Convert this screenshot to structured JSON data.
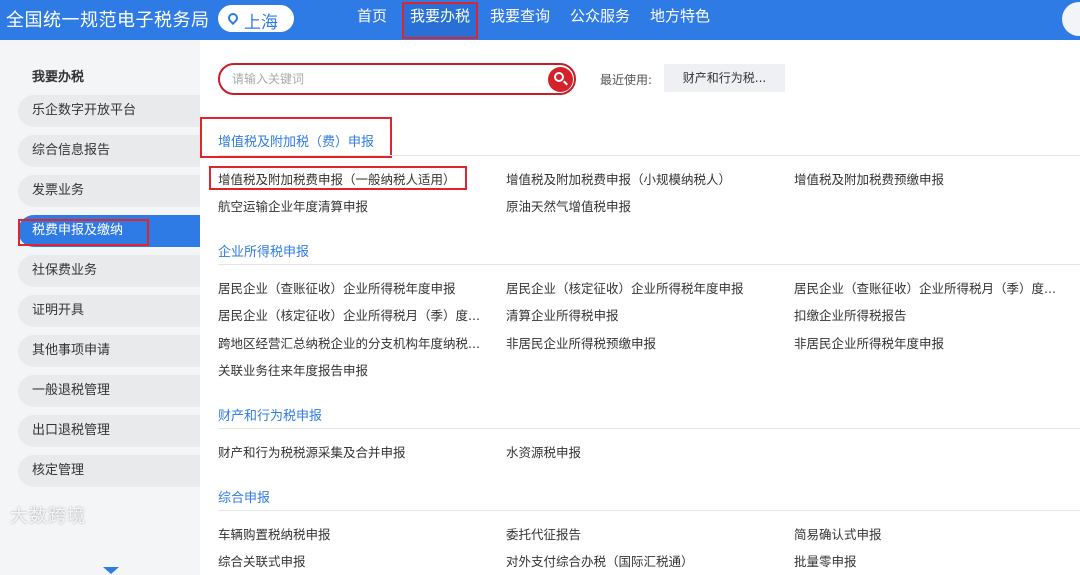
{
  "header": {
    "site_title": "全国统一规范电子税务局",
    "location": "上海",
    "nav": [
      "首页",
      "我要办税",
      "我要查询",
      "公众服务",
      "地方特色"
    ],
    "active_nav": "我要办税"
  },
  "sidebar": {
    "title": "我要办税",
    "items": [
      "乐企数字开放平台",
      "综合信息报告",
      "发票业务",
      "税费申报及缴纳",
      "社保费业务",
      "证明开具",
      "其他事项申请",
      "一般退税管理",
      "出口退税管理",
      "核定管理"
    ],
    "active_item": "税费申报及缴纳",
    "watermark": "大数跨境"
  },
  "search": {
    "placeholder": "请输入关键词",
    "value": "",
    "recent_label": "最近使用:",
    "recent_items": [
      "财产和行为税..."
    ]
  },
  "sections": [
    {
      "title": "增值税及附加税（费）申报",
      "items": [
        "增值税及附加税费申报（一般纳税人适用）",
        "增值税及附加税费申报（小规模纳税人）",
        "增值税及附加税费预缴申报",
        "航空运输企业年度清算申报",
        "原油天然气增值税申报"
      ]
    },
    {
      "title": "企业所得税申报",
      "items": [
        "居民企业（查账征收）企业所得税年度申报",
        "居民企业（核定征收）企业所得税年度申报",
        "居民企业（查账征收）企业所得税月（季）度...",
        "居民企业（核定征收）企业所得税月（季）度...",
        "清算企业所得税申报",
        "扣缴企业所得税报告",
        "跨地区经营汇总纳税企业的分支机构年度纳税...",
        "非居民企业所得税预缴申报",
        "非居民企业所得税年度申报",
        "关联业务往来年度报告申报"
      ]
    },
    {
      "title": "财产和行为税申报",
      "items": [
        "财产和行为税税源采集及合并申报",
        "水资源税申报"
      ]
    },
    {
      "title": "综合申报",
      "items": [
        "车辆购置税纳税申报",
        "委托代征报告",
        "简易确认式申报",
        "综合关联式申报",
        "对外支付综合办税（国际汇税通）",
        "批量零申报"
      ]
    }
  ],
  "colors": {
    "primary": "#2f7be5",
    "highlight_border": "#e0242b",
    "search_border": "#c81d25"
  }
}
